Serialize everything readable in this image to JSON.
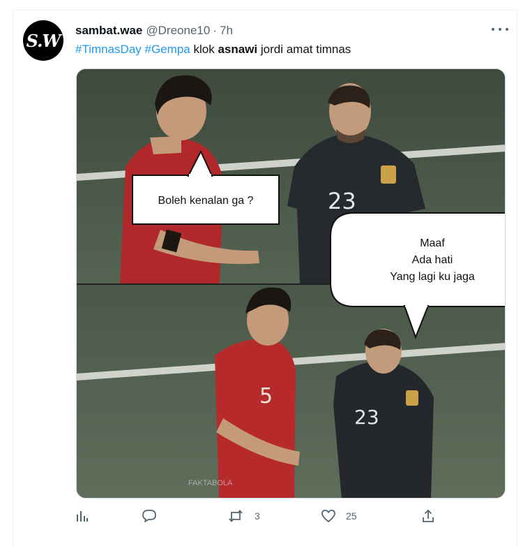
{
  "tweet": {
    "author": {
      "avatar_text": "S.W",
      "display_name": "sambat.wae",
      "handle": "@Dreone10",
      "separator": "·",
      "time": "7h"
    },
    "text": {
      "hashtag_1": "#TimnasDay",
      "hashtag_2": "#Gempa",
      "word_1": "klok",
      "bold_word": "asnawi",
      "rest": "jordi amat timnas"
    },
    "media": {
      "bubble_top": "Boleh kenalan ga ?",
      "bubble_bottom_lines": [
        "Maaf",
        "Ada hati",
        "Yang lagi ku jaga"
      ],
      "jersey_numbers": {
        "red": "5",
        "dark_top": "23",
        "dark_bottom": "23"
      },
      "watermark": "FAKTABOLA"
    },
    "actions": {
      "views_icon": "bar-chart-icon",
      "reply_icon": "reply-icon",
      "retweet_icon": "retweet-icon",
      "retweet_count": "3",
      "like_icon": "heart-icon",
      "like_count": "25",
      "share_icon": "share-icon"
    }
  },
  "colors": {
    "link": "#1d9bf0",
    "secondary_text": "#536471",
    "primary_text": "#0f1419",
    "border": "#cfd9de"
  }
}
